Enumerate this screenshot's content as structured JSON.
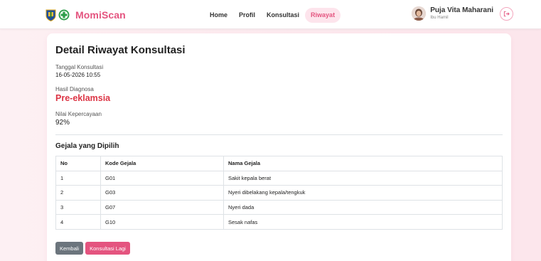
{
  "brand": {
    "name": "MomiScan"
  },
  "nav": {
    "items": [
      "Home",
      "Profil",
      "Konsultasi",
      "Riwayat"
    ],
    "active": "Riwayat"
  },
  "user": {
    "name": "Puja Vita Maharani",
    "role": "Ibu Hamil"
  },
  "detail": {
    "title": "Detail Riwayat Konsultasi",
    "date_label": "Tanggal Konsultasi",
    "date_value": "16-05-2026 10:55",
    "diagnosis_label": "Hasil Diagnosa",
    "diagnosis_value": "Pre-eklamsia",
    "confidence_label": "Nilai Kepercayaan",
    "confidence_value": "92%"
  },
  "symptoms": {
    "title": "Gejala yang Dipilih",
    "headers": [
      "No",
      "Kode Gejala",
      "Nama Gejala"
    ],
    "rows": [
      [
        "1",
        "G01",
        "Sakit kepala berat"
      ],
      [
        "2",
        "G03",
        "Nyeri dibelakang kepala/tengkuk"
      ],
      [
        "3",
        "G07",
        "Nyeri dada"
      ],
      [
        "4",
        "G10",
        "Sesak nafas"
      ]
    ]
  },
  "actions": {
    "back": "Kembali",
    "again": "Konsultasi Lagi"
  },
  "colors": {
    "brand": "#e4547f",
    "diagnosis": "#dc3545",
    "back_button": "#6c757d"
  },
  "icons": {
    "logo_left": "shield-emblem-icon",
    "logo_right": "health-plus-icon",
    "logout": "logout-icon"
  }
}
